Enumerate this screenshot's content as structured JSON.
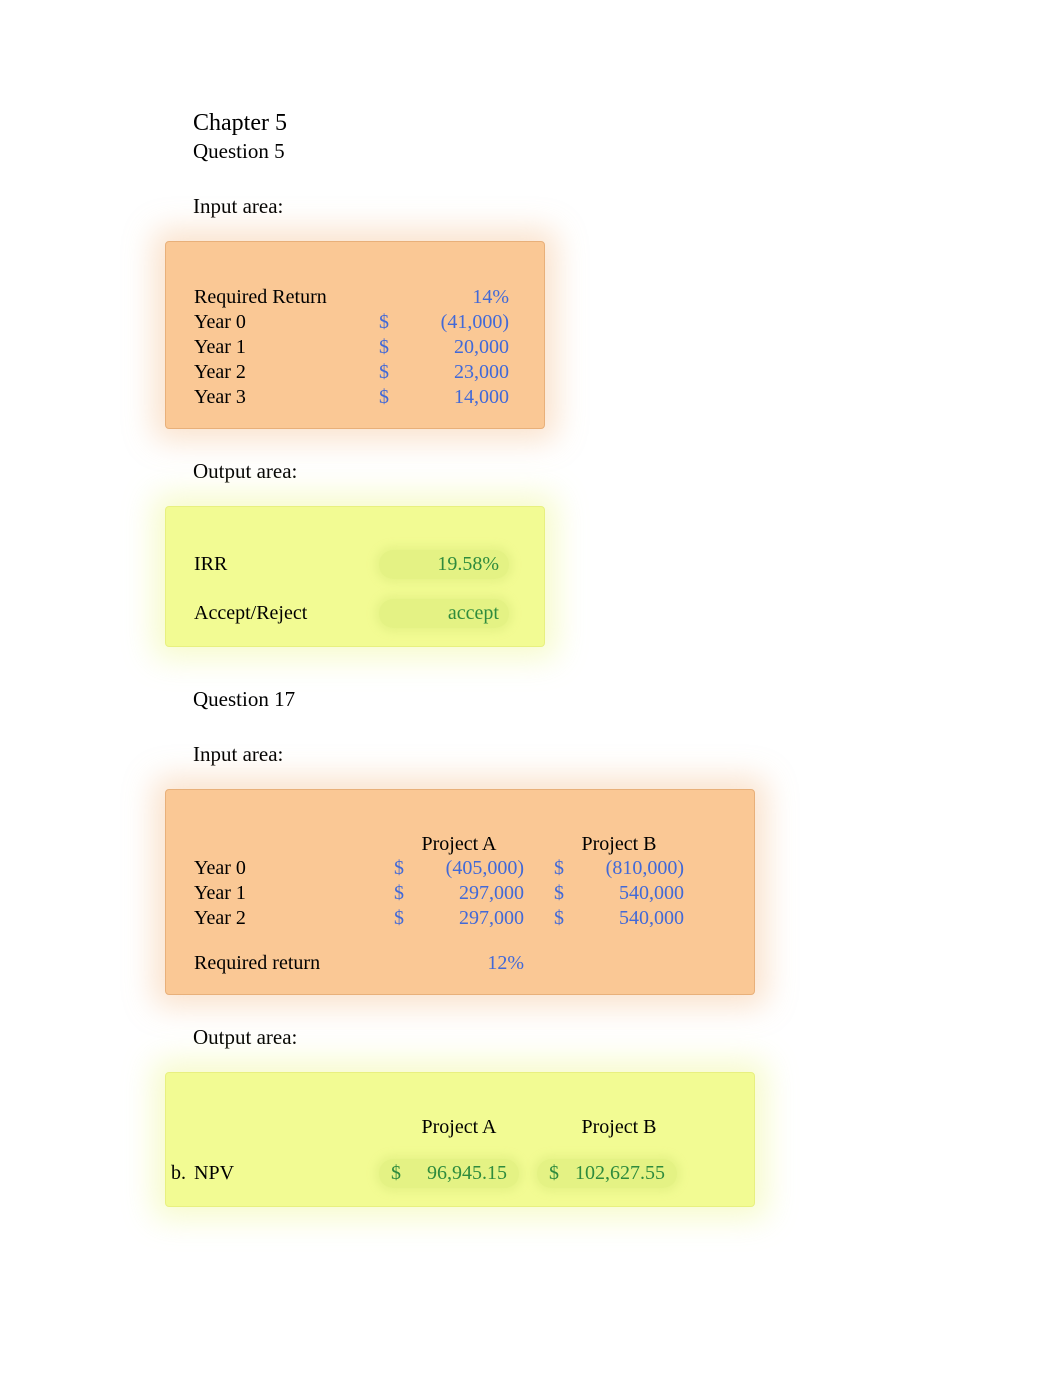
{
  "chapter_title": "Chapter 5",
  "q5": {
    "question_label": "Question 5",
    "input_label": "Input area:",
    "output_label": "Output area:",
    "inputs": {
      "required_return_label": "Required Return",
      "required_return_value": "14%",
      "rows": [
        {
          "label": "Year 0",
          "sym": "$",
          "value": "(41,000)"
        },
        {
          "label": "Year 1",
          "sym": "$",
          "value": "20,000"
        },
        {
          "label": "Year 2",
          "sym": "$",
          "value": "23,000"
        },
        {
          "label": "Year 3",
          "sym": "$",
          "value": "14,000"
        }
      ]
    },
    "outputs": {
      "irr_label": "IRR",
      "irr_value": "19.58%",
      "decision_label": "Accept/Reject",
      "decision_value": "accept"
    }
  },
  "q17": {
    "question_label": "Question 17",
    "input_label": "Input area:",
    "output_label": "Output area:",
    "headers": {
      "project_a": "Project A",
      "project_b": "Project B"
    },
    "inputs": {
      "rows": [
        {
          "label": "Year 0",
          "a_sym": "$",
          "a_val": "(405,000)",
          "b_sym": "$",
          "b_val": "(810,000)"
        },
        {
          "label": "Year 1",
          "a_sym": "$",
          "a_val": "297,000",
          "b_sym": "$",
          "b_val": "540,000"
        },
        {
          "label": "Year 2",
          "a_sym": "$",
          "a_val": "297,000",
          "b_sym": "$",
          "b_val": "540,000"
        }
      ],
      "required_return_label": "Required return",
      "required_return_value": "12%"
    },
    "outputs": {
      "bullet": "b.",
      "npv_label": "NPV",
      "a_sym": "$",
      "a_val": "96,945.15",
      "b_sym": "$",
      "b_val": "102,627.55"
    }
  }
}
